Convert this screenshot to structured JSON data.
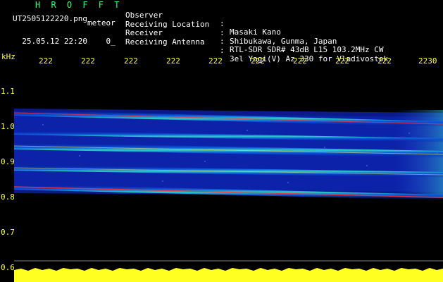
{
  "header": {
    "brand": "H R O F F T",
    "filename": "UT2505122220.png",
    "mode": "meteor",
    "datetime": "25.05.12 22:20",
    "status": "0_"
  },
  "info": [
    {
      "key": "Observer",
      "value": "Masaki Kano"
    },
    {
      "key": "Receiving Location",
      "value": "Shibukawa, Gunma, Japan"
    },
    {
      "key": "Receiver",
      "value": "RTL-SDR SDR# 43dB L15 103.2MHz CW"
    },
    {
      "key": "Receiving Antenna",
      "value": "3el Yagi(V) Az 330 for Vladivostok"
    }
  ],
  "separator": ":",
  "axes": {
    "y_unit": "kHz",
    "y_ticks": [
      "1.1",
      "1.0",
      "0.9",
      "0.8",
      "0.7",
      "0.6"
    ],
    "x_ticks": [
      "222",
      "222",
      "222",
      "222",
      "222",
      "222",
      "222",
      "222",
      "222",
      "2230"
    ]
  },
  "colors": {
    "text": "#ffffff",
    "brand": "#33ff66",
    "axis": "#ffff33",
    "background": "#000000"
  }
}
